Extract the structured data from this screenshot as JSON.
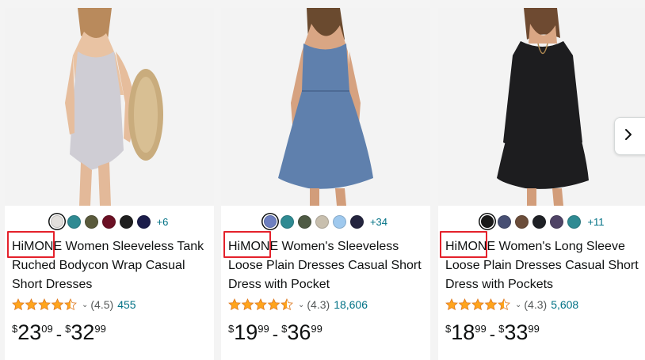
{
  "products": [
    {
      "brand": "HiMONE",
      "title_rest": " Women Sleeveless Tank Ruched Bodycon Wrap Casual Short Dresses",
      "image": "light gray sleeveless bodycon dress",
      "dress_color": "#cfcdd4",
      "swatches": [
        "#e2dfdc",
        "#2f8a92",
        "#5a5a3c",
        "#6b1024",
        "#1f1f1f",
        "#1b1d4a"
      ],
      "selected_swatch": 0,
      "more_colors": "+6",
      "rating": 4.5,
      "rating_text": "(4.5)",
      "review_count": "455",
      "price_low": {
        "symbol": "$",
        "whole": "23",
        "fraction": "09"
      },
      "price_high": {
        "symbol": "$",
        "whole": "32",
        "fraction": "99"
      }
    },
    {
      "brand": "HiMONE",
      "title_rest": " Women's Sleeveless Loose Plain Dresses Casual Short Dress with Pocket",
      "image": "blue sleeveless loose dress with pockets",
      "dress_color": "#5f80ad",
      "swatches": [
        "#6e7fc0",
        "#2f8a92",
        "#4e5a44",
        "#c8bfae",
        "#9fc9ee",
        "#24253f"
      ],
      "selected_swatch": 0,
      "more_colors": "+34",
      "rating": 4.5,
      "rating_text": "(4.3)",
      "review_count": "18,606",
      "price_low": {
        "symbol": "$",
        "whole": "19",
        "fraction": "99"
      },
      "price_high": {
        "symbol": "$",
        "whole": "36",
        "fraction": "99"
      }
    },
    {
      "brand": "HiMONE",
      "title_rest": " Women's Long Sleeve Loose Plain Dresses Casual Short Dress with Pockets",
      "image": "black long sleeve loose dress with pockets",
      "dress_color": "#1d1d1f",
      "swatches": [
        "#1a1a1a",
        "#474f73",
        "#6b4d3a",
        "#1f2126",
        "#4f4466",
        "#2f8a92"
      ],
      "selected_swatch": 0,
      "more_colors": "+11",
      "rating": 4.5,
      "rating_text": "(4.3)",
      "review_count": "5,608",
      "price_low": {
        "symbol": "$",
        "whole": "18",
        "fraction": "99"
      },
      "price_high": {
        "symbol": "$",
        "whole": "33",
        "fraction": "99"
      }
    }
  ],
  "colors": {
    "star": "#ffa41c",
    "link": "#007185",
    "highlight": "#e4212b"
  },
  "carousel": {
    "next_icon": "chevron-right-icon"
  }
}
